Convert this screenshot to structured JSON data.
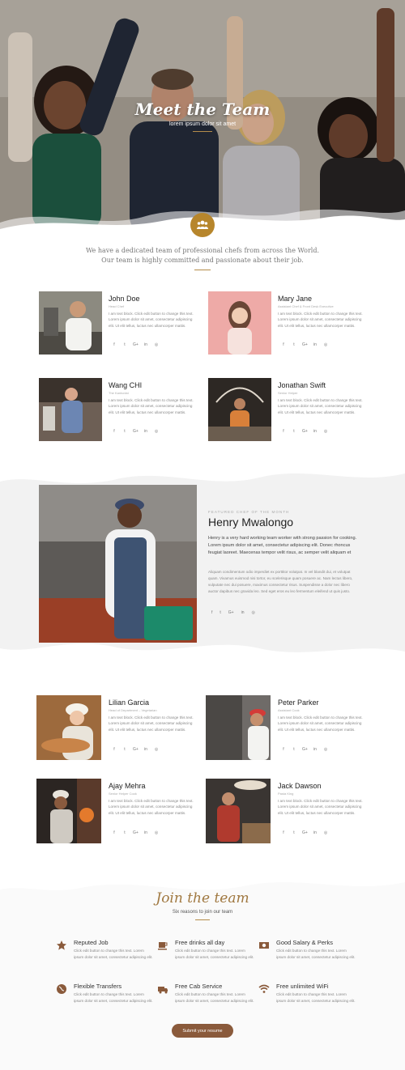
{
  "hero": {
    "title": "Meet the Team",
    "subtitle": "lorem ipsum dolor sit amet"
  },
  "intro": {
    "line1": "We have a dedicated team of professional chefs from across the World.",
    "line2": "Our team is highly committed and passionate about their job."
  },
  "colors": {
    "accent": "#b7862c",
    "brown": "#8a5a3b",
    "title_gold": "#a07840"
  },
  "team_top": [
    {
      "name": "John Doe",
      "role": "Head Chef",
      "bio": "I am text block. Click edit button to change this text. Lorem ipsum dolor sit amet, consectetur adipiscing elit. Ut elit tellus, luctus nec ullamcorper mattis."
    },
    {
      "name": "Mary Jane",
      "role": "Assistant Chef & Front Desk Executive",
      "bio": "I am text block. Click edit button to change this text. Lorem ipsum dolor sit amet, consectetur adipiscing elit. Ut elit tellus, luctus nec ullamcorper mattis."
    },
    {
      "name": "Wang CHI",
      "role": "The Kantonist",
      "bio": "I am text block. Click edit button to change this text. Lorem ipsum dolor sit amet, consectetur adipiscing elit. Ut elit tellus, luctus nec ullamcorper mattis."
    },
    {
      "name": "Jonathan Swift",
      "role": "Senior Helper",
      "bio": "I am text block. Click edit button to change this text. Lorem ipsum dolor sit amet, consectetur adipiscing elit. Ut elit tellus, luctus nec ullamcorper mattis."
    }
  ],
  "social_icons": [
    "f",
    "t",
    "G+",
    "in",
    "◎"
  ],
  "featured": {
    "kicker": "FEATURED CHEF OF THE MONTH",
    "name": "Henry Mwalongo",
    "p1": "Henry is a very hard working team worker with strong passion for cooking. Lorem ipsum dolor sit amet, consectetur adipiscing elit. Donec rhoncus feugiat laoreet. Maecenas tempor velit risus, ac semper velit aliquam et",
    "p2": "Aliquam condimentum odio imperdiet ex porttitor volutpat. In vel blandit dui, et volutpat quam. Vivamus euismod nisi tortor, eu scelerisque quam posuere ac. Nam lectus libero, vulputate nec dui posuere, maximus consectetur risus. Suspendisse a dolor nec libero auctor dapibus nec gravida leo. Sed eget eros eu leo fermentum eleifend ut quis justo."
  },
  "team_bottom": [
    {
      "name": "Lilian Garcia",
      "role": "Head of Department – Vegetarian",
      "bio": "I am text block. Click edit button to change this text. Lorem ipsum dolor sit amet, consectetur adipiscing elit. Ut elit tellus, luctus nec ullamcorper mattis."
    },
    {
      "name": "Peter Parker",
      "role": "Assistant Cook",
      "bio": "I am text block. Click edit button to change this text. Lorem ipsum dolor sit amet, consectetur adipiscing elit. Ut elit tellus, luctus nec ullamcorper mattis."
    },
    {
      "name": "Ajay Mehra",
      "role": "Senior Helper Cook",
      "bio": "I am text block. Click edit button to change this text. Lorem ipsum dolor sit amet, consectetur adipiscing elit. Ut elit tellus, luctus nec ullamcorper mattis."
    },
    {
      "name": "Jack Dawson",
      "role": "Pasta King",
      "bio": "I am text block. Click edit button to change this text. Lorem ipsum dolor sit amet, consectetur adipiscing elit. Ut elit tellus, luctus nec ullamcorper mattis."
    }
  ],
  "join": {
    "title": "Join the team",
    "subtitle": "Six reasons to join our team",
    "reasons": [
      {
        "title": "Reputed Job",
        "icon": "star-icon",
        "desc": "Click edit button to change this text. Lorem ipsum dolor sit amet, consectetur adipiscing elit."
      },
      {
        "title": "Free drinks all day",
        "icon": "coffee-icon",
        "desc": "Click edit button to change this text. Lorem ipsum dolor sit amet, consectetur adipiscing elit."
      },
      {
        "title": "Good Salary & Perks",
        "icon": "money-icon",
        "desc": "Click edit button to change this text. Lorem ipsum dolor sit amet, consectetur adipiscing elit."
      },
      {
        "title": "Flexible Transfers",
        "icon": "globe-icon",
        "desc": "Click edit button to change this text. Lorem ipsum dolor sit amet, consectetur adipiscing elit."
      },
      {
        "title": "Free Cab Service",
        "icon": "truck-icon",
        "desc": "Click edit button to change this text. Lorem ipsum dolor sit amet, consectetur adipiscing elit."
      },
      {
        "title": "Free unlimited WiFi",
        "icon": "wifi-icon",
        "desc": "Click edit button to change this text. Lorem ipsum dolor sit amet, consectetur adipiscing elit."
      }
    ],
    "button": "Submit your resume"
  }
}
